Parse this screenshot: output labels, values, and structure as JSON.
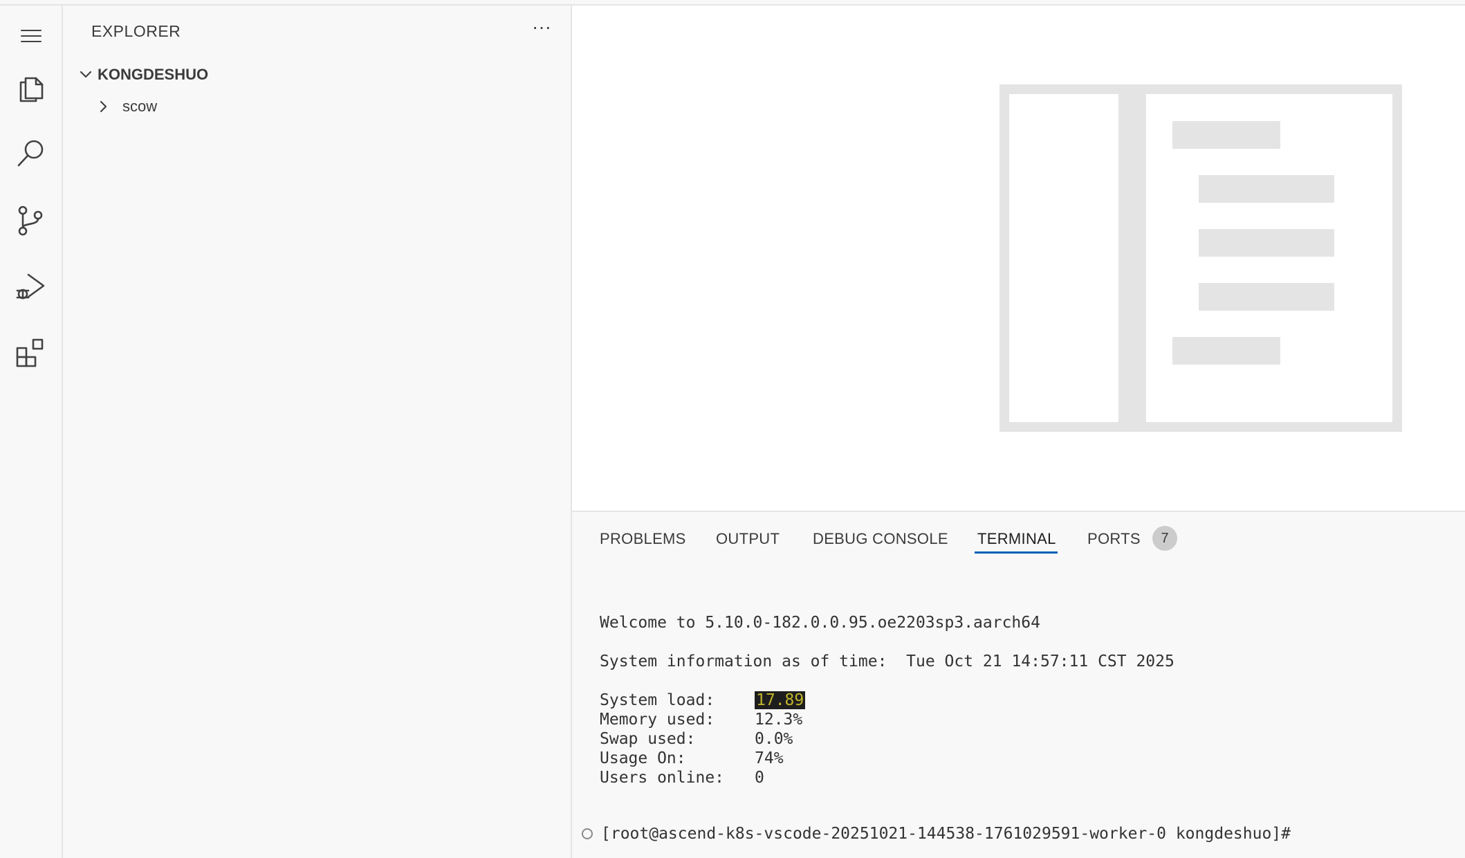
{
  "explorer": {
    "title": "EXPLORER",
    "more_label": "···",
    "root": "KONGDESHUO",
    "items": [
      {
        "label": "scow"
      }
    ]
  },
  "activity_bar": {
    "icons": [
      "menu-icon",
      "files-icon",
      "search-icon",
      "source-control-icon",
      "run-debug-icon",
      "extensions-icon"
    ]
  },
  "panel": {
    "tabs": [
      "PROBLEMS",
      "OUTPUT",
      "DEBUG CONSOLE",
      "TERMINAL",
      "PORTS"
    ],
    "active_tab": "TERMINAL",
    "ports_badge": "7"
  },
  "terminal": {
    "welcome": "Welcome to 5.10.0-182.0.0.95.oe2203sp3.aarch64",
    "sysinfo_label": "System information as of time:",
    "sysinfo_time": "Tue Oct 21 14:57:11 CST 2025",
    "stats": [
      {
        "label": "System load:",
        "value": "17.89",
        "highlight": true
      },
      {
        "label": "Memory used:",
        "value": "12.3%"
      },
      {
        "label": "Swap used:",
        "value": "0.0%"
      },
      {
        "label": "Usage On:",
        "value": "74%"
      },
      {
        "label": "Users online:",
        "value": "0"
      }
    ],
    "prompt": "[root@ascend-k8s-vscode-20251021-144538-1761029591-worker-0 kongdeshuo]#"
  },
  "colors": {
    "accent": "#005fb8",
    "highlight_bg": "#1e1e1e",
    "highlight_fg": "#c0b42a"
  }
}
